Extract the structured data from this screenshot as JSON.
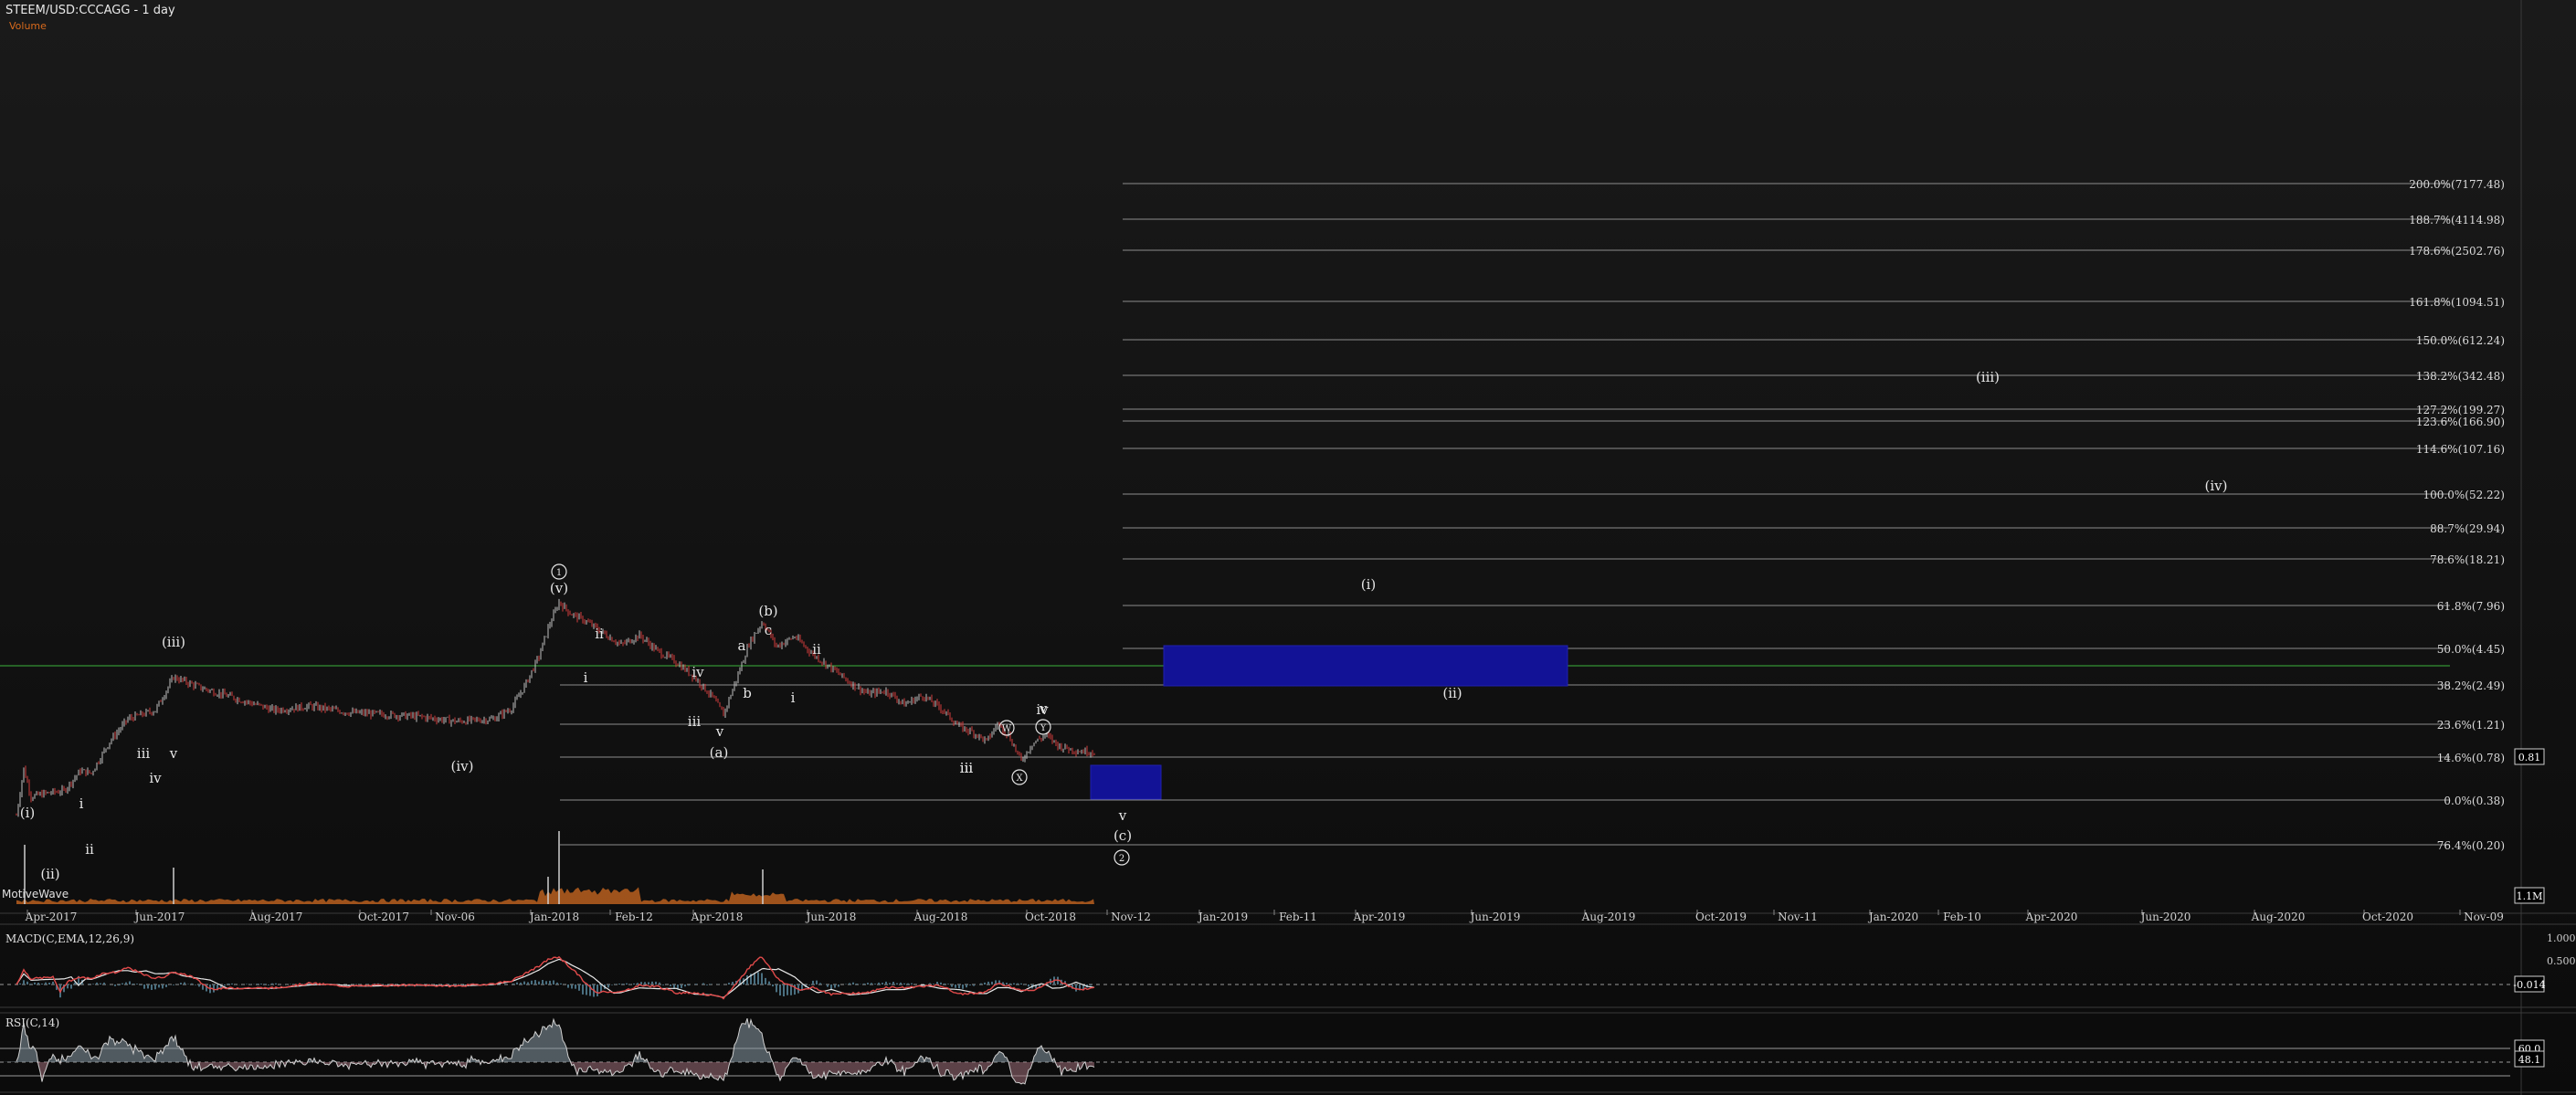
{
  "header": {
    "title": "STEEM/USD:CCCAGG - 1 day",
    "volume_label": "Volume",
    "watermark": "MotiveWave"
  },
  "colors": {
    "background": "#121212",
    "up_bar": "#c0c0c0",
    "down_bar": "#d23c3c",
    "fib_line": "#8c8c8c",
    "horizontal_green": "#3cb43c",
    "target_box": "#121296",
    "volume": "#b85f1e",
    "macd_line": "#e04a4a",
    "signal_line": "#e8e8e8",
    "histogram": "#4a6f80",
    "rsi_line": "#d0d0d0"
  },
  "time_axis": [
    "Apr-2017",
    "Jun-2017",
    "Aug-2017",
    "Oct-2017",
    "Nov-06",
    "Jan-2018",
    "Feb-12",
    "Apr-2018",
    "Jun-2018",
    "Aug-2018",
    "Oct-2018",
    "Nov-12",
    "Jan-2019",
    "Feb-11",
    "Apr-2019",
    "Jun-2019",
    "Aug-2019",
    "Oct-2019",
    "Nov-11",
    "Jan-2020",
    "Feb-10",
    "Apr-2020",
    "Jun-2020",
    "Aug-2020",
    "Oct-2020",
    "Nov-09"
  ],
  "fib_levels": [
    "200.0%(7177.48)",
    "188.7%(4114.98)",
    "178.6%(2502.76)",
    "161.8%(1094.51)",
    "150.0%(612.24)",
    "138.2%(342.48)",
    "127.2%(199.27)",
    "123.6%(166.90)",
    "114.6%(107.16)",
    "100.0%(52.22)",
    "88.7%(29.94)",
    "78.6%(18.21)",
    "61.8%(7.96)",
    "50.0%(4.45)",
    "38.2%(2.49)",
    "23.6%(1.21)",
    "14.6%(0.78)",
    "0.0%(0.38)",
    "76.4%(0.20)"
  ],
  "price_tag": "0.81",
  "volume_tag": "1.1M",
  "macd": {
    "label": "MACD(C,EMA,12,26,9)",
    "ticks": [
      "1.000",
      "0.500"
    ],
    "value": "-0.014"
  },
  "rsi": {
    "label": "RSI(C,14)",
    "ticks": [
      "60.0"
    ],
    "value": "48.1"
  },
  "wave_labels": [
    "(i)",
    "(ii)",
    "i",
    "ii",
    "iii",
    "iv",
    "v",
    "(iii)",
    "(iv)",
    "(v)",
    "i",
    "ii",
    "iii",
    "iv",
    "v",
    "(a)",
    "a",
    "b",
    "c",
    "(b)",
    "i",
    "ii",
    "iii",
    "iv",
    "v",
    "(c)",
    "(i)",
    "(ii)",
    "(iii)",
    "(iv)"
  ],
  "circled_labels": [
    "1",
    "2",
    "W",
    "X",
    "Y"
  ],
  "chart_data": {
    "type": "line",
    "title": "STEEM/USD:CCCAGG - 1 day",
    "x": [
      "Apr-2017",
      "Jun-2017",
      "Aug-2017",
      "Oct-2017",
      "Nov-06",
      "Jan-2018",
      "Feb-12",
      "Apr-2018",
      "Jun-2018",
      "Aug-2018",
      "Oct-2018"
    ],
    "series": [
      {
        "values": [
          0.9,
          1.3,
          1.05,
          1.0,
          0.95,
          7.9,
          4.2,
          2.6,
          3.4,
          1.3,
          0.81
        ]
      }
    ],
    "y_scale": "log",
    "grid": false,
    "last_price": 0.81
  }
}
